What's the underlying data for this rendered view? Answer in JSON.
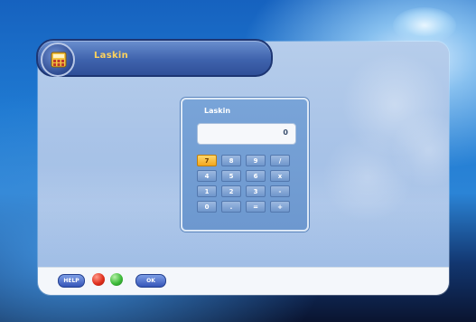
{
  "app": {
    "title": "Laskin"
  },
  "calculator": {
    "title": "Laskin",
    "display_value": "0",
    "active_key": "7",
    "keys": [
      {
        "label": "7"
      },
      {
        "label": "8"
      },
      {
        "label": "9"
      },
      {
        "label": "/"
      },
      {
        "label": "4"
      },
      {
        "label": "5"
      },
      {
        "label": "6"
      },
      {
        "label": "x"
      },
      {
        "label": "1"
      },
      {
        "label": "2"
      },
      {
        "label": "3"
      },
      {
        "label": "-"
      },
      {
        "label": "0"
      },
      {
        "label": "."
      },
      {
        "label": "="
      },
      {
        "label": "+"
      }
    ]
  },
  "footer": {
    "help_label": "HELP",
    "ok_label": "OK",
    "red_button_color": "#e0301e",
    "green_button_color": "#3dbb3a"
  },
  "colors": {
    "accent": "#ffd35c",
    "active_key": "#f2a81e"
  },
  "icons": {
    "app_icon": "calculator-app-icon"
  }
}
